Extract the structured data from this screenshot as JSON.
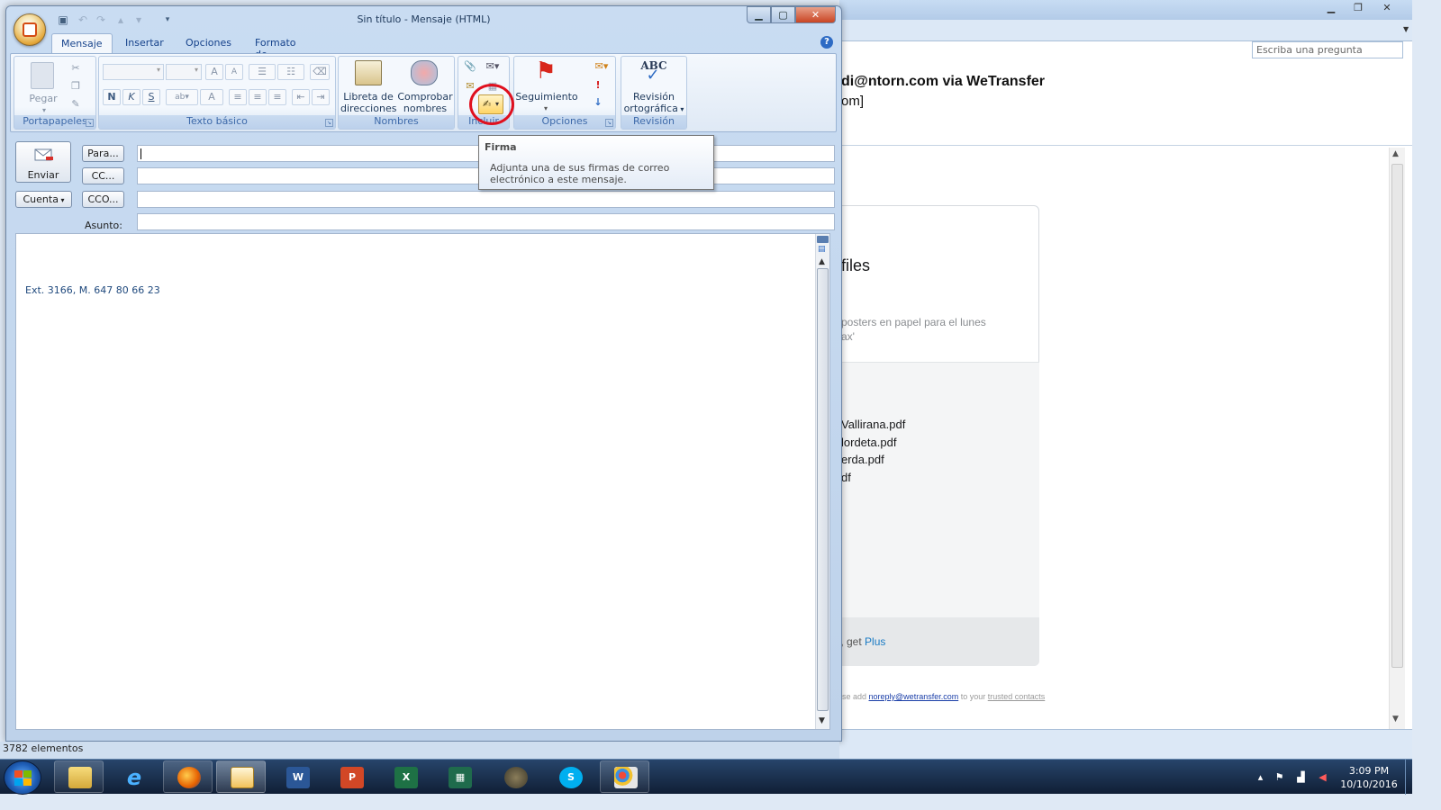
{
  "background_window": {
    "search_placeholder": "Escriba una pregunta",
    "from_line": "di@ntorn.com via WeTransfer",
    "from_line2": "om]",
    "card_title": "files",
    "message_line1": "posters en papel para el lunes",
    "message_line2": "ax'",
    "files": [
      "Vallirana.pdf",
      "lordeta.pdf",
      "erda.pdf",
      "df"
    ],
    "footer_text": "r, get ",
    "footer_link": "Plus",
    "small_prefix": "ase add ",
    "small_link": "noreply@wetransfer.com",
    "small_mid": " to your ",
    "small_link2": "trusted contacts"
  },
  "window": {
    "title": "Sin título - Mensaje (HTML)"
  },
  "ribbon": {
    "tabs": [
      "Mensaje",
      "Insertar",
      "Opciones",
      "Formato de texto"
    ],
    "groups": {
      "portapapeles": "Portapapeles",
      "texto_basico": "Texto básico",
      "nombres": "Nombres",
      "incluir": "Incluir",
      "opciones": "Opciones",
      "revision": "Revisión"
    },
    "buttons": {
      "pegar": "Pegar",
      "libreta_1": "Libreta de",
      "libreta_2": "direcciones",
      "comprobar_1": "Comprobar",
      "comprobar_2": "nombres",
      "seguimiento": "Seguimiento",
      "revision_icon_text": "ABC",
      "revision_1": "Revisión",
      "revision_2": "ortográfica",
      "bold": "N",
      "italic": "K",
      "underline": "S"
    }
  },
  "tooltip": {
    "title": "Firma",
    "body": "Adjunta una de sus firmas de correo electrónico a este mensaje."
  },
  "compose": {
    "send": "Enviar",
    "to": "Para...",
    "cc": "CC...",
    "bcc": "CCO...",
    "account": "Cuenta",
    "subject_label": "Asunto:",
    "body_text": "Ext. 3166, M. 647 80 66 23"
  },
  "status_bar": {
    "text": "3782 elementos"
  },
  "taskbar": {
    "time": "3:09 PM",
    "date": "10/10/2016"
  },
  "colors": {
    "highlight_circle": "#e0101e",
    "body_text": "#1f497d",
    "link": "#1a7bc4"
  }
}
